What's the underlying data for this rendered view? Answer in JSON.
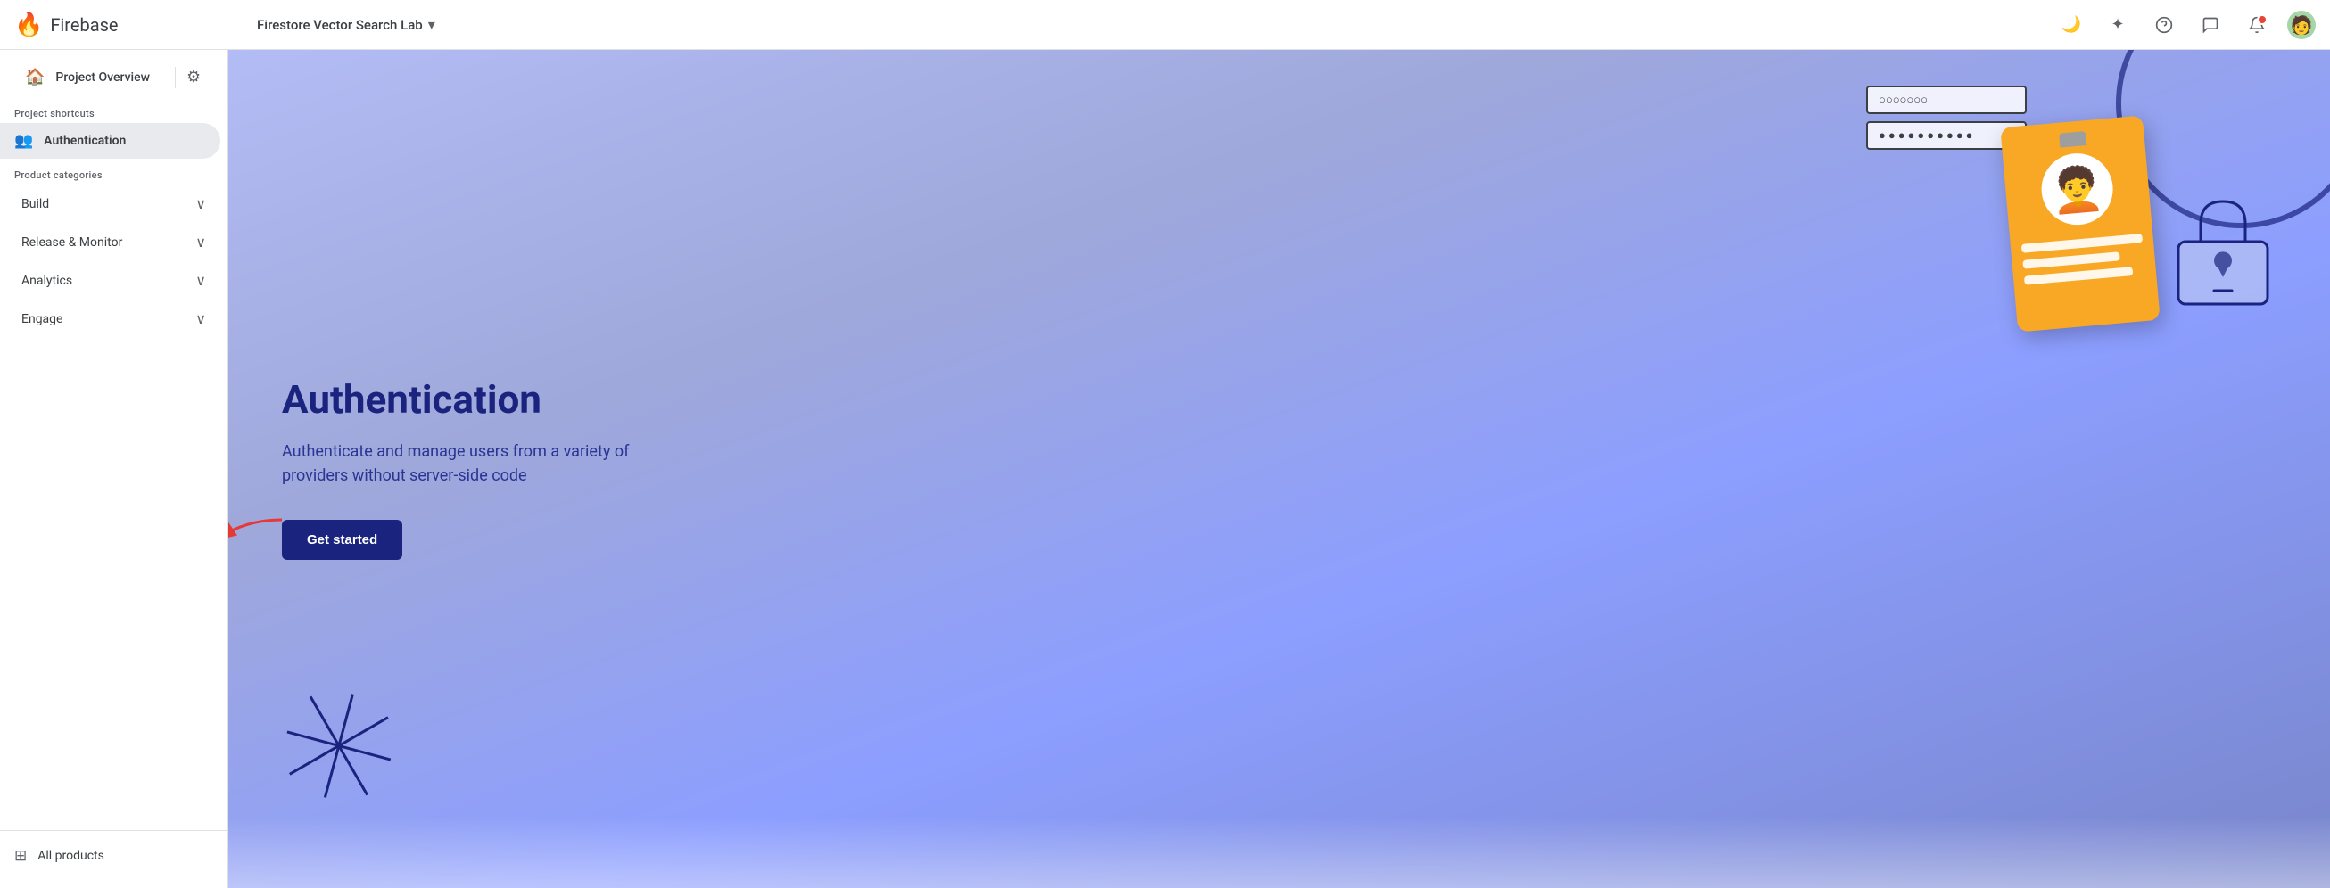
{
  "topbar": {
    "logo_text": "Firebase",
    "project_name": "Firestore Vector Search Lab",
    "chevron": "▾",
    "icons": {
      "dark_mode": "🌙",
      "sparkle": "✦",
      "help": "?",
      "chat": "💬",
      "notification": "🔔",
      "avatar": "👤"
    }
  },
  "sidebar": {
    "overview_label": "Project Overview",
    "sections": {
      "project_shortcuts_label": "Project shortcuts",
      "product_categories_label": "Product categories"
    },
    "shortcuts": [
      {
        "id": "authentication",
        "label": "Authentication",
        "icon": "👤",
        "active": true
      }
    ],
    "categories": [
      {
        "id": "build",
        "label": "Build"
      },
      {
        "id": "release-monitor",
        "label": "Release & Monitor"
      },
      {
        "id": "analytics",
        "label": "Analytics"
      },
      {
        "id": "engage",
        "label": "Engage"
      }
    ],
    "all_products_label": "All products"
  },
  "hero": {
    "title": "Authentication",
    "description": "Authenticate and manage users from a variety of providers without server-side code",
    "cta_label": "Get started"
  },
  "illustration": {
    "password_dots_1": "○○○○○○○",
    "password_dots_2": "●●●●●●●●●●"
  }
}
